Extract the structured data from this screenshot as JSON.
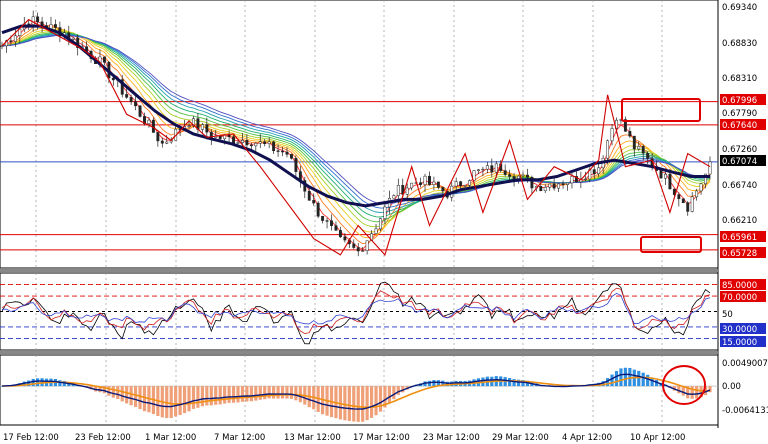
{
  "chart_data": [
    {
      "type": "line",
      "panel": "price",
      "ylim": [
        0.6545,
        0.6955
      ],
      "price_ticks": [
        "0.69340",
        "0.68830",
        "0.68310",
        "0.67790",
        "0.67260",
        "0.66740",
        "0.66210"
      ],
      "horizontal_lines": [
        {
          "value": 0.67996,
          "label": "0.67996",
          "color": "#e00000"
        },
        {
          "value": 0.6764,
          "label": "0.67640",
          "color": "#e00000"
        },
        {
          "value": 0.67074,
          "label": "0.67074",
          "color": "#3050c8"
        },
        {
          "value": 0.65961,
          "label": "0.65961",
          "color": "#e00000"
        },
        {
          "value": 0.65728,
          "label": "0.65728",
          "color": "#e00000"
        }
      ],
      "current_price": "0.67074",
      "series": [
        {
          "values": [
            0.688,
            0.6915,
            0.6925,
            0.69,
            0.686,
            0.683,
            0.681,
            0.679,
            0.676,
            0.674,
            0.673,
            0.6735,
            0.6745,
            0.672,
            0.669,
            0.667,
            0.665,
            0.664,
            0.664,
            0.665,
            0.666,
            0.6668,
            0.6672,
            0.668,
            0.669,
            0.6695,
            0.67,
            0.6702,
            0.67,
            0.6705,
            0.6712,
            0.672,
            0.6715,
            0.6705,
            0.67,
            0.6695,
            0.669,
            0.6688
          ]
        },
        {
          "values": [
            0.6905,
            0.6915,
            0.6915,
            0.6905,
            0.6885,
            0.686,
            0.6835,
            0.681,
            0.6785,
            0.6765,
            0.675,
            0.6742,
            0.6735,
            0.6725,
            0.671,
            0.669,
            0.667,
            0.6655,
            0.6645,
            0.664,
            0.6645,
            0.665,
            0.665,
            0.6655,
            0.6665,
            0.667,
            0.6675,
            0.668,
            0.668,
            0.6685,
            0.6695,
            0.6705,
            0.671,
            0.6705,
            0.67,
            0.6692,
            0.6685,
            0.6685
          ]
        }
      ]
    },
    {
      "type": "line",
      "panel": "oscillator",
      "ylim": [
        0,
        100
      ],
      "levels": [
        {
          "value": 85,
          "label": "85.0000",
          "color": "#e00000"
        },
        {
          "value": 70,
          "label": "70.0000",
          "color": "#e00000"
        },
        {
          "value": 50,
          "label": "50",
          "color": "#000000"
        },
        {
          "value": 30,
          "label": "30.0000",
          "color": "#2030c8"
        },
        {
          "value": 15,
          "label": "15.0000",
          "color": "#2030c8"
        }
      ]
    },
    {
      "type": "bar",
      "panel": "macd",
      "ylim": [
        -0.0065,
        0.0052
      ],
      "ticks": [
        "0.0049007",
        "0.00",
        "-0.0064131"
      ]
    }
  ],
  "time_labels": [
    "17 Feb 12:00",
    "23 Feb 12:00",
    "1 Mar 12:00",
    "7 Mar 12:00",
    "13 Mar 12:00",
    "17 Mar 12:00",
    "23 Mar 12:00",
    "29 Mar 12:00",
    "4 Apr 12:00",
    "10 Apr 12:00"
  ],
  "colors": {
    "resistance": "#e00000",
    "current": "#3050c8",
    "ma_thick": "#101050",
    "zigzag": "#d00000",
    "hist_pos": "#3090e0",
    "hist_neg": "#f0a078",
    "macd_main": "#0a1a7a",
    "macd_signal": "#f09010",
    "highlight": "#e00000"
  }
}
